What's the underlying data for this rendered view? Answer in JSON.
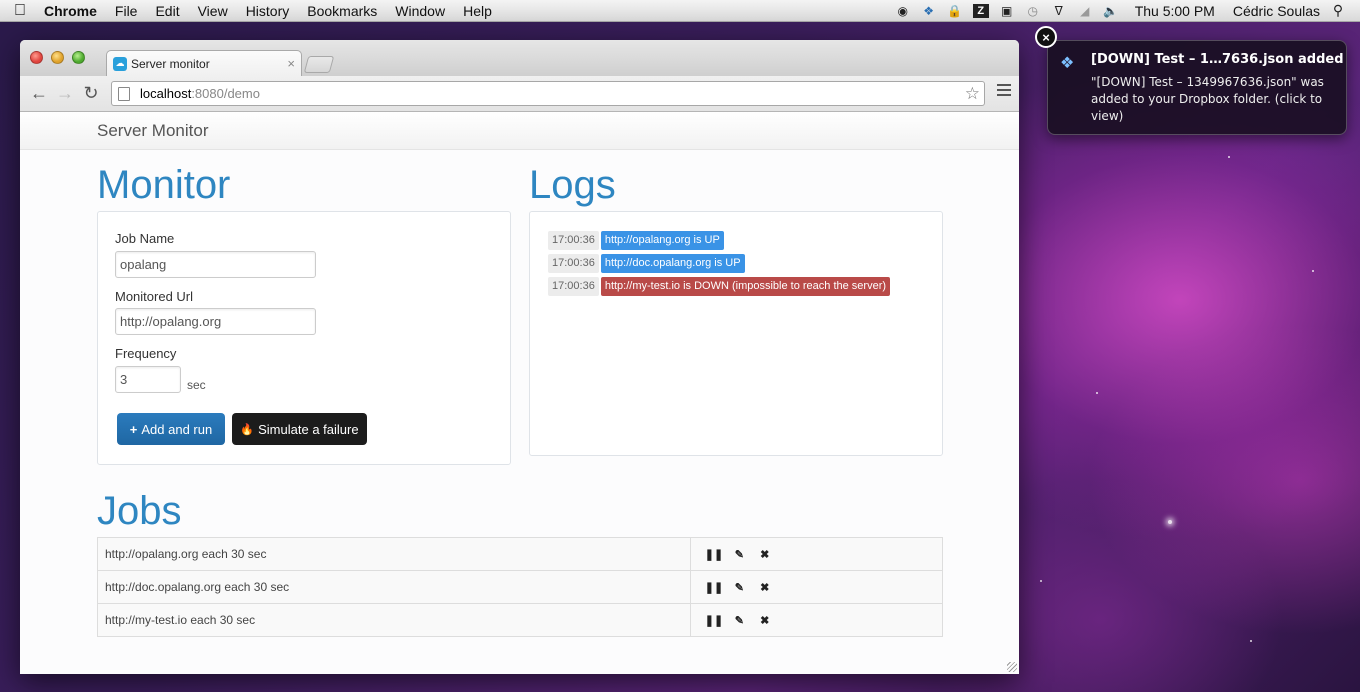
{
  "menubar": {
    "apple_icon": "apple-logo",
    "app_name": "Chrome",
    "items": [
      "File",
      "Edit",
      "View",
      "History",
      "Bookmarks",
      "Window",
      "Help"
    ],
    "clock": "Thu 5:00 PM",
    "user": "Cédric Soulas"
  },
  "browser": {
    "tab_title": "Server monitor",
    "url_host": "localhost",
    "url_path": ":8080/demo"
  },
  "page": {
    "brand": "Server Monitor",
    "monitor": {
      "title": "Monitor",
      "job_name_label": "Job Name",
      "job_name_value": "opalang",
      "url_label": "Monitored Url",
      "url_value": "http://opalang.org",
      "frequency_label": "Frequency",
      "frequency_value": "3",
      "frequency_unit": "sec",
      "add_button": "Add and run",
      "simulate_button": "Simulate a failure"
    },
    "logs": {
      "title": "Logs",
      "entries": [
        {
          "time": "17:00:36",
          "message": "http://opalang.org is UP",
          "status": "up"
        },
        {
          "time": "17:00:36",
          "message": "http://doc.opalang.org is UP",
          "status": "up"
        },
        {
          "time": "17:00:36",
          "message": "http://my-test.io is DOWN (impossible to reach the server)",
          "status": "down"
        }
      ]
    },
    "jobs": {
      "title": "Jobs",
      "rows": [
        {
          "label": "http://opalang.org each 30 sec"
        },
        {
          "label": "http://doc.opalang.org each 30 sec"
        },
        {
          "label": "http://my-test.io each 30 sec"
        }
      ]
    }
  },
  "notification": {
    "title": "[DOWN] Test – 1…7636.json added",
    "body": "\"[DOWN] Test – 1349967636.json\" was added to your Dropbox folder. (click to view)"
  },
  "colors": {
    "accent": "#2e86c1",
    "up": "#3a93e6",
    "down": "#b94a48",
    "primary_button": "#1f67a3",
    "dark_button": "#1c1c1c"
  }
}
